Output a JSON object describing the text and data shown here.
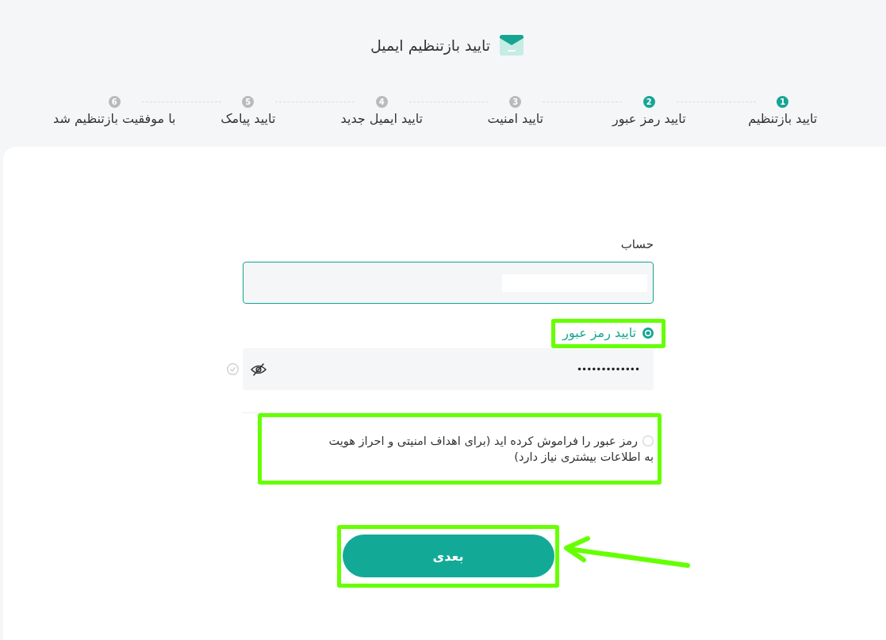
{
  "header": {
    "title": "تایید بازتنظیم ایمیل"
  },
  "steps": [
    {
      "number": "1",
      "label": "تایید بازتنظیم",
      "active": true
    },
    {
      "number": "2",
      "label": "تایید رمز عبور",
      "active": true
    },
    {
      "number": "3",
      "label": "تایید امنیت",
      "active": false
    },
    {
      "number": "4",
      "label": "تایید ایمیل جدید",
      "active": false
    },
    {
      "number": "5",
      "label": "تایید پیامک",
      "active": false
    },
    {
      "number": "6",
      "label": "با موفقیت بازتنظیم شد",
      "active": false
    }
  ],
  "form": {
    "account": {
      "label": "حساب",
      "redacted": true
    },
    "options": [
      {
        "kind": "password",
        "label": "تایید رمز عبور",
        "selected": true,
        "highlighted": true,
        "value": "•••••••••••••",
        "verified": false
      },
      {
        "kind": "plain",
        "label": "رمز عبور را فراموش کرده اید (برای اهداف امنیتی و احراز هویت به اطلاعات بیشتری نیاز دارد)",
        "selected": false,
        "highlighted": true
      }
    ]
  },
  "next_button": {
    "label": "بعدی",
    "highlighted": true,
    "pointed_at": true
  }
}
